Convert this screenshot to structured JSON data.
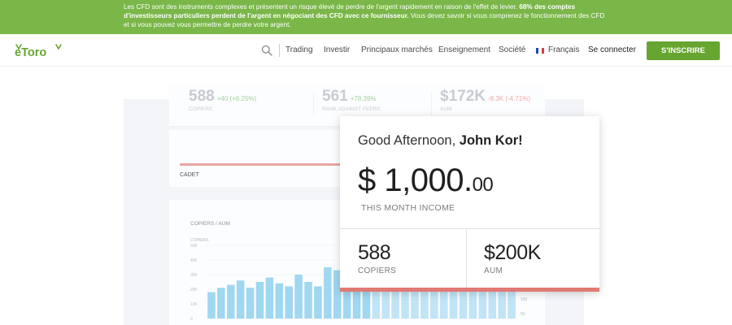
{
  "risk_warning": {
    "line1_pre": "Les CFD sont des instruments complexes et présentent un risque élevé de perdre de l'argent rapidement en raison de l'effet de levier. ",
    "line1_bold": "68% des comptes d'investisseurs particuliers perdent de l'argent en négociant des CFD avec ce fournisseur.",
    "line1_post": " Vous devez savoir si vous comprenez le fonctionnement des CFD et si vous pouvez vous permettre de perdre votre argent."
  },
  "header": {
    "logo_text": "eToro",
    "nav": [
      "Trading",
      "Investir",
      "Principaux marchés",
      "Enseignement",
      "Société"
    ],
    "language": "Français",
    "login_label": "Se connecter",
    "signup_label": "S'INSCRIRE"
  },
  "background_stats": [
    {
      "value": "588",
      "change": "+40 (+6.25%)",
      "label": "COPIERS",
      "change_color": "#9ed29b"
    },
    {
      "value": "561",
      "change": "+78.39%",
      "label": "RANK AGAINST PEERS",
      "change_color": "#9ed29b"
    },
    {
      "value": "$172K",
      "change": "-8.3K (-4.71%)",
      "label": "AUM",
      "change_color": "#f0a8a4"
    }
  ],
  "rank_card": {
    "level_label": "CADET"
  },
  "bg_chart": {
    "title": "COPIERS / AUM",
    "series_label": "COPIERS",
    "y_ticks": [
      "500",
      "400",
      "300",
      "200",
      "100",
      "0"
    ],
    "right_ticks": [
      "100",
      "50"
    ],
    "bars": [
      180,
      210,
      230,
      260,
      210,
      250,
      280,
      240,
      220,
      300,
      250,
      220,
      350,
      330,
      300,
      230,
      280,
      240,
      220,
      300,
      250,
      300,
      280,
      270,
      300,
      280,
      260,
      250,
      230,
      260,
      220,
      200
    ]
  },
  "hero_card": {
    "greeting": "Good Afternoon, ",
    "user_name": "John Kor!",
    "income_main": "$ 1,000.",
    "income_cents": "00",
    "income_label": "THIS MONTH INCOME",
    "stats": [
      {
        "value": "588",
        "label": "COPIERS"
      },
      {
        "value": "$200K",
        "label": "AUM"
      }
    ]
  },
  "colors": {
    "brand_green": "#66a530",
    "risk_bar_green": "#7ab648",
    "card_accent": "#e07a73",
    "bar_blue": "#8fd0ee"
  }
}
